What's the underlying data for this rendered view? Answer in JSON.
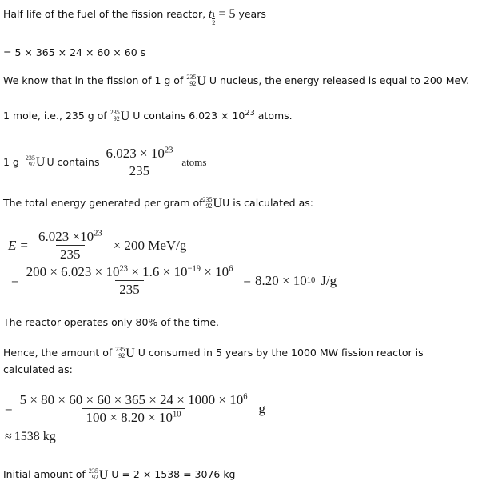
{
  "document": {
    "type": "physics-solution",
    "topic": "Nuclear fission reactor fuel consumption",
    "background_color": "#ffffff",
    "text_color": "#000000"
  },
  "lines": {
    "half_life_prefix": "Half life of the fuel of the fission reactor,",
    "half_life_symbol_t": "t",
    "half_life_sub_num": "1",
    "half_life_sub_den": "2",
    "half_life_equals": "=",
    "half_life_value": "5",
    "half_life_unit": "years",
    "seconds_conversion": "= 5 × 365 × 24 × 60 × 60 s",
    "fission_text_a": "We know that in the fission of 1 g of",
    "fission_text_b": "U nucleus, the energy released is equal to 200 MeV.",
    "mole_text_a": "1 mole, i.e., 235 g of",
    "mole_text_b": "U contains 6.023 × 10",
    "mole_exponent": "23",
    "mole_text_c": " atoms.",
    "gram_text_a": "1 g",
    "gram_text_b": "U contains",
    "gram_num_mantissa": "6.023 × 10",
    "gram_num_exponent": "23",
    "gram_den": "235",
    "gram_text_c": "atoms",
    "total_energy_text_a": "The total energy generated per gram of",
    "total_energy_text_b": "U is calculated as:",
    "energy_eq1_var": "E",
    "energy_eq1_equals": "=",
    "energy_eq1_num_mantissa": "6.023 ×10",
    "energy_eq1_num_exponent": "23",
    "energy_eq1_den": "235",
    "energy_eq1_tail": "× 200 MeV/g",
    "energy_eq2_equals": "=",
    "energy_eq2_num_p1": "200 × 6.023 × 10",
    "energy_eq2_num_e1": "23",
    "energy_eq2_num_p2": " × 1.6 × 10",
    "energy_eq2_num_e2": "−19",
    "energy_eq2_num_p3": " × 10",
    "energy_eq2_num_e3": "6",
    "energy_eq2_den": "235",
    "energy_eq2_result_equals": "=",
    "energy_eq2_result_mantissa": "8.20 × 10",
    "energy_eq2_result_exponent": "10",
    "energy_eq2_result_unit": "J/g",
    "reactor_duty": "The reactor operates only 80% of the time.",
    "hence_text_a": "Hence, the amount of",
    "hence_text_b": "U consumed in 5 years by the 1000 MW fission reactor is",
    "hence_text_c": "calculated as:",
    "mass_eq_equals": "=",
    "mass_eq_num_p1": "5 × 80 × 60 × 60 × 365 × 24 × 1000 × 10",
    "mass_eq_num_e1": "6",
    "mass_eq_den_p1": "100 × 8.20 × 10",
    "mass_eq_den_e1": "10",
    "mass_eq_unit": "g",
    "mass_result_approx": "≈",
    "mass_result_value": "1538 kg",
    "initial_text_a": "Initial amount of",
    "initial_text_b": "U = 2 × 1538 = 3076 kg"
  },
  "isotope": {
    "mass_number": "235",
    "atomic_number": "92",
    "element": "U"
  }
}
